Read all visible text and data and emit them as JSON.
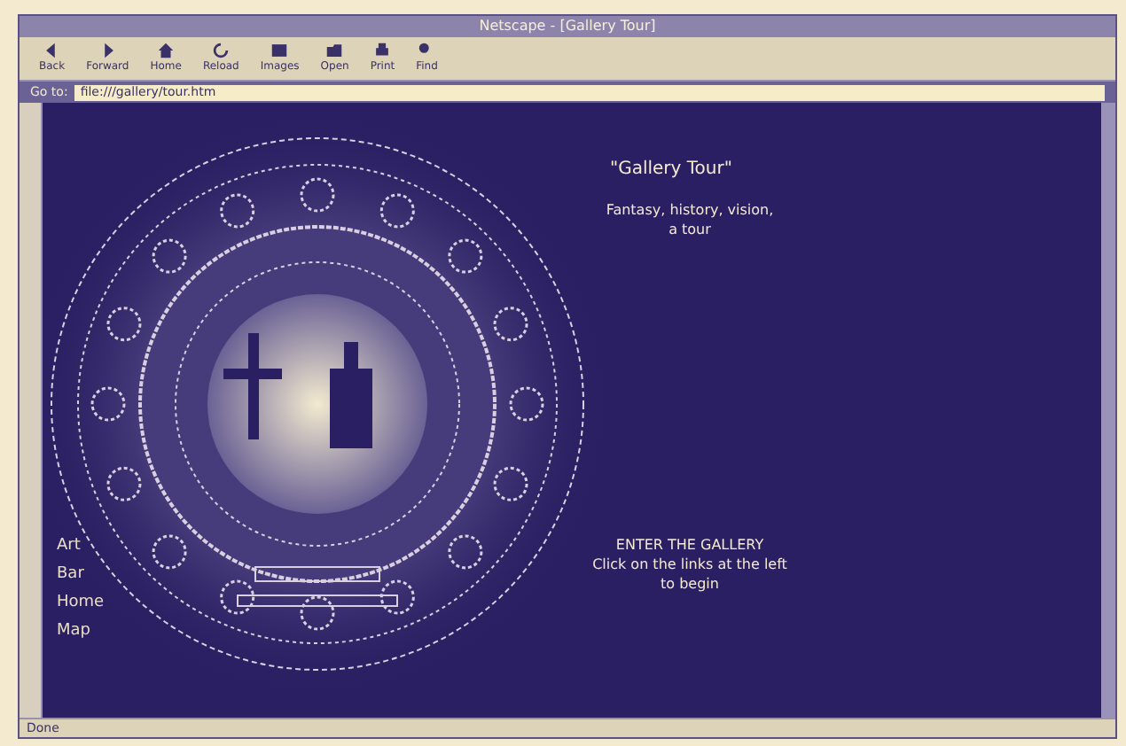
{
  "window": {
    "title": "Netscape - [Gallery Tour]"
  },
  "toolbar": [
    {
      "label": "Back"
    },
    {
      "label": "Forward"
    },
    {
      "label": "Home"
    },
    {
      "label": "Reload"
    },
    {
      "label": "Images"
    },
    {
      "label": "Open"
    },
    {
      "label": "Print"
    },
    {
      "label": "Find"
    }
  ],
  "location": {
    "label": "Go to:",
    "value": "file:///gallery/tour.htm"
  },
  "page": {
    "title": "\"Gallery Tour\"",
    "intro": [
      "Fantasy, history, vision,",
      "a tour"
    ],
    "footer": [
      "ENTER THE GALLERY",
      "Click on the links at the left",
      "to begin"
    ],
    "links": [
      "Art",
      "Bar",
      "Home",
      "Map"
    ]
  },
  "status_bar": {
    "text": "Done"
  }
}
